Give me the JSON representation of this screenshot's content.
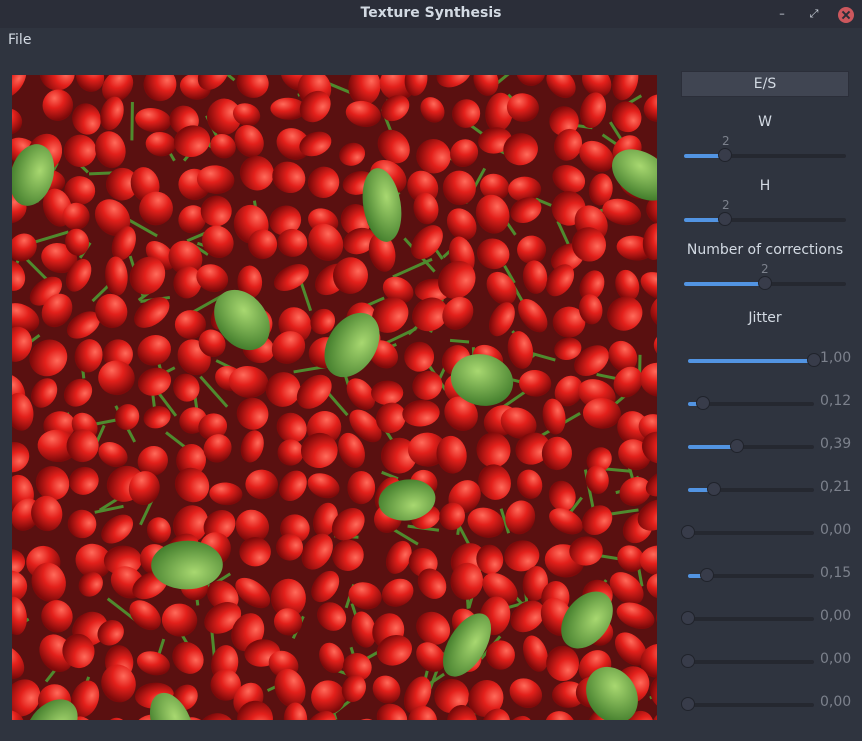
{
  "window": {
    "title": "Texture Synthesis"
  },
  "menu": {
    "file": "File"
  },
  "controls": {
    "es_button": "E/S",
    "w": {
      "label": "W",
      "value": "2",
      "fraction": 0.25
    },
    "h": {
      "label": "H",
      "value": "2",
      "fraction": 0.25
    },
    "corrections": {
      "label": "Number of corrections",
      "value": "2",
      "fraction": 0.5
    },
    "jitter": {
      "label": "Jitter",
      "sliders": [
        {
          "value": "1,00",
          "fraction": 1.0
        },
        {
          "value": "0,12",
          "fraction": 0.12
        },
        {
          "value": "0,39",
          "fraction": 0.39
        },
        {
          "value": "0,21",
          "fraction": 0.21
        },
        {
          "value": "0,00",
          "fraction": 0.0
        },
        {
          "value": "0,15",
          "fraction": 0.15
        },
        {
          "value": "0,00",
          "fraction": 0.0
        },
        {
          "value": "0,00",
          "fraction": 0.0
        },
        {
          "value": "0,00",
          "fraction": 0.0
        }
      ]
    }
  },
  "colors": {
    "accent": "#5294e2",
    "background": "#2f343f",
    "close": "#cc575d"
  },
  "icons": [
    "minimize-icon",
    "maximize-icon",
    "close-icon"
  ]
}
